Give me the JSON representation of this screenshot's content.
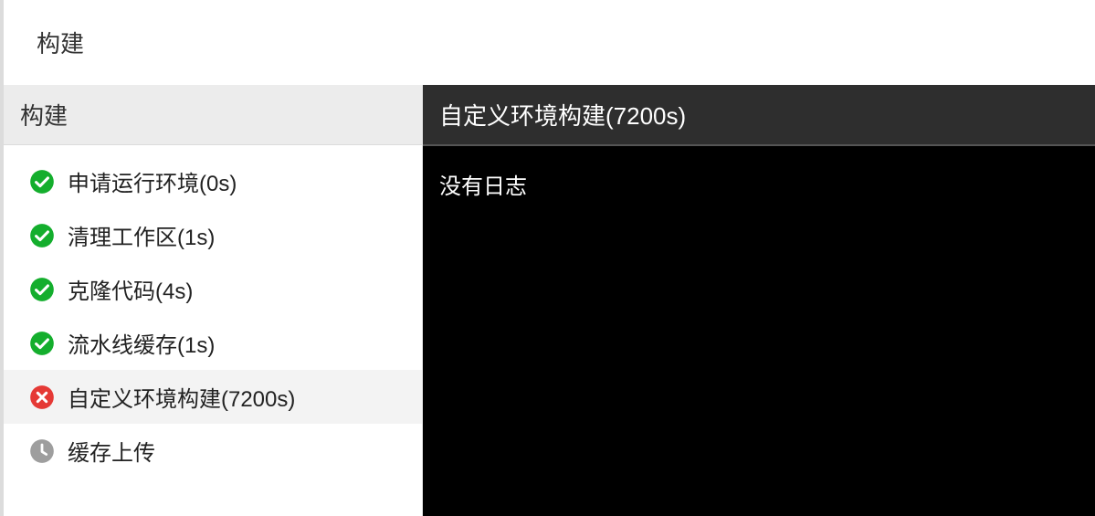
{
  "topTitle": "构建",
  "left": {
    "header": "构建",
    "steps": [
      {
        "status": "success",
        "label": "申请运行环境(0s)",
        "selected": false
      },
      {
        "status": "success",
        "label": "清理工作区(1s)",
        "selected": false
      },
      {
        "status": "success",
        "label": "克隆代码(4s)",
        "selected": false
      },
      {
        "status": "success",
        "label": "流水线缓存(1s)",
        "selected": false
      },
      {
        "status": "error",
        "label": "自定义环境构建(7200s)",
        "selected": true
      },
      {
        "status": "pending",
        "label": "缓存上传",
        "selected": false
      }
    ]
  },
  "right": {
    "header": "自定义环境构建(7200s)",
    "logEmptyMessage": "没有日志"
  },
  "icons": {
    "successColor": "#14ae2d",
    "errorColor": "#e53935",
    "pendingColor": "#9e9e9e"
  }
}
